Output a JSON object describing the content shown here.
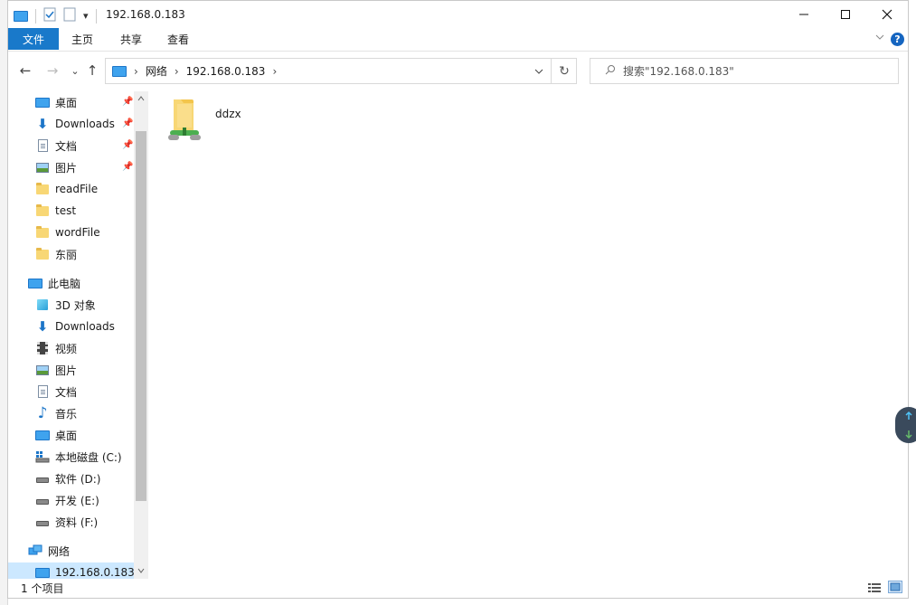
{
  "window": {
    "title": "192.168.0.183"
  },
  "ribbon": {
    "tabs": [
      "文件",
      "主页",
      "共享",
      "查看"
    ],
    "help_label": "?"
  },
  "nav": {
    "back": "←",
    "forward": "→",
    "recent": "⌄",
    "up": "↑",
    "breadcrumb": [
      "网络",
      "192.168.0.183"
    ],
    "refresh": "↻",
    "dropdown": "⌄"
  },
  "search": {
    "placeholder": "搜索\"192.168.0.183\""
  },
  "sidebar": {
    "quick_access": [
      {
        "label": "桌面",
        "icon": "desktop-icon",
        "pinned": true
      },
      {
        "label": "Downloads",
        "icon": "download-icon",
        "pinned": true
      },
      {
        "label": "文档",
        "icon": "document-icon",
        "pinned": true
      },
      {
        "label": "图片",
        "icon": "picture-icon",
        "pinned": true
      },
      {
        "label": "readFile",
        "icon": "folder-icon",
        "pinned": false
      },
      {
        "label": "test",
        "icon": "folder-icon",
        "pinned": false
      },
      {
        "label": "wordFile",
        "icon": "folder-icon",
        "pinned": false
      },
      {
        "label": "东丽",
        "icon": "folder-icon",
        "pinned": false
      }
    ],
    "this_pc": {
      "label": "此电脑",
      "items": [
        {
          "label": "3D 对象",
          "icon": "3d-objects-icon"
        },
        {
          "label": "Downloads",
          "icon": "download-icon"
        },
        {
          "label": "视频",
          "icon": "video-icon"
        },
        {
          "label": "图片",
          "icon": "picture-icon"
        },
        {
          "label": "文档",
          "icon": "document-icon"
        },
        {
          "label": "音乐",
          "icon": "music-icon"
        },
        {
          "label": "桌面",
          "icon": "desktop-icon"
        },
        {
          "label": "本地磁盘 (C:)",
          "icon": "system-drive-icon"
        },
        {
          "label": "软件 (D:)",
          "icon": "drive-icon"
        },
        {
          "label": "开发 (E:)",
          "icon": "drive-icon"
        },
        {
          "label": "资料 (F:)",
          "icon": "drive-icon"
        }
      ]
    },
    "network": {
      "label": "网络",
      "items": [
        {
          "label": "192.168.0.183",
          "icon": "computer-icon",
          "selected": true
        }
      ]
    }
  },
  "content": {
    "items": [
      {
        "label": "ddzx",
        "icon": "shared-folder-icon"
      }
    ]
  },
  "status": {
    "item_count": "1 个项目"
  },
  "colors": {
    "accent": "#1979ca",
    "selection": "#cce8ff",
    "folder": "#f8d775"
  }
}
